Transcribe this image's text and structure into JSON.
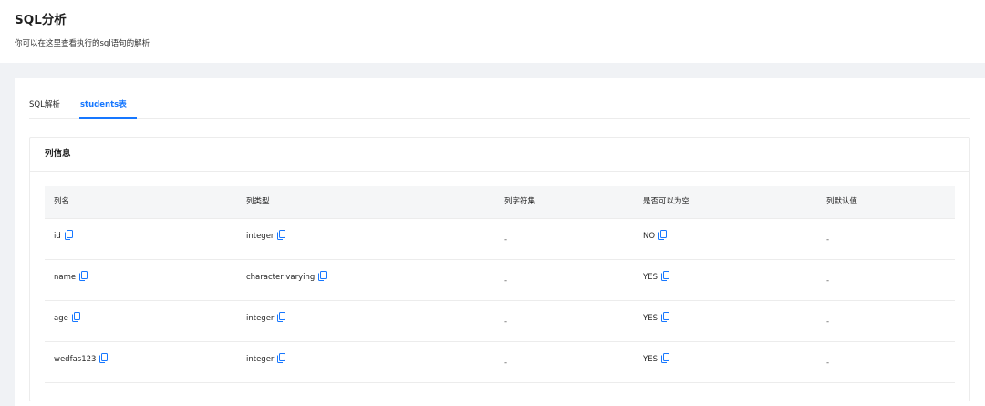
{
  "header": {
    "title": "SQL分析",
    "subtitle": "你可以在这里查看执行的sql语句的解析"
  },
  "tabs": [
    {
      "label": "SQL解析",
      "active": false
    },
    {
      "label": "students表",
      "active": true
    }
  ],
  "card": {
    "title": "列信息"
  },
  "table": {
    "headers": [
      "列名",
      "列类型",
      "列字符集",
      "是否可以为空",
      "列默认值"
    ],
    "rows": [
      {
        "name": "id",
        "type": "integer",
        "charset": "-",
        "nullable": "NO",
        "default": "-"
      },
      {
        "name": "name",
        "type": "character varying",
        "charset": "-",
        "nullable": "YES",
        "default": "-"
      },
      {
        "name": "age",
        "type": "integer",
        "charset": "-",
        "nullable": "YES",
        "default": "-"
      },
      {
        "name": "wedfas123",
        "type": "integer",
        "charset": "-",
        "nullable": "YES",
        "default": "-"
      }
    ]
  },
  "colors": {
    "accent": "#1677ff",
    "background": "#f0f2f5",
    "table_header_bg": "#f5f6f7"
  },
  "icons": {
    "copy": "copy-icon"
  }
}
